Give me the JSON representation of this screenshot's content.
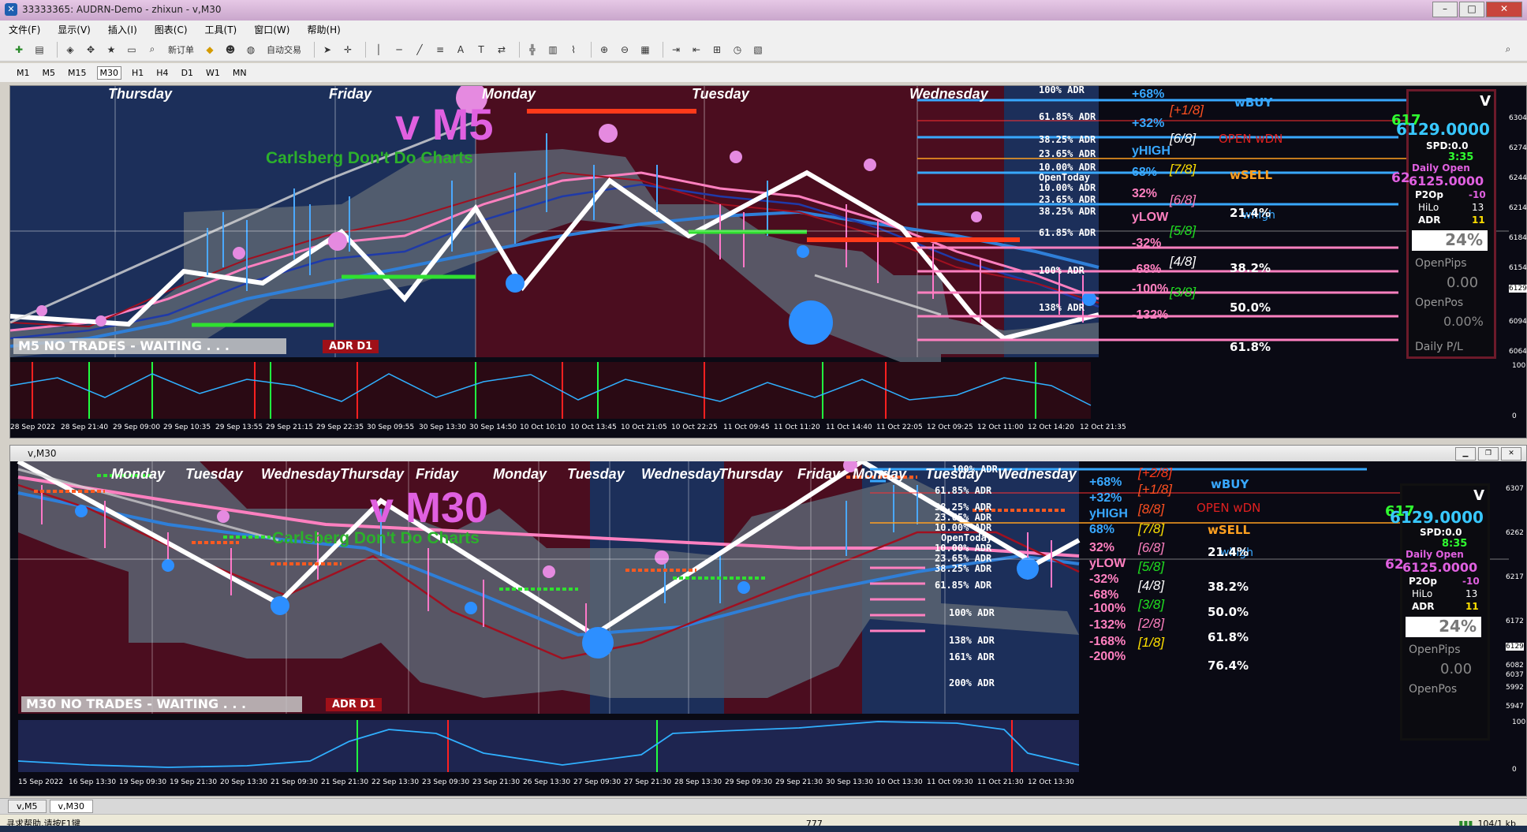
{
  "window": {
    "title": "33333365: AUDRN-Demo - zhixun - v,M30",
    "min": "–",
    "max": "□",
    "close": "✕"
  },
  "menu": [
    "文件(F)",
    "显示(V)",
    "插入(I)",
    "图表(C)",
    "工具(T)",
    "窗口(W)",
    "帮助(H)"
  ],
  "toolbar": {
    "new_order": "新订单",
    "auto_trade": "自动交易"
  },
  "timeframes": [
    "M1",
    "M5",
    "M15",
    "M30",
    "H1",
    "H4",
    "D1",
    "W1",
    "MN"
  ],
  "chart1": {
    "days": [
      "Thursday",
      "Friday",
      "Monday",
      "Tuesday",
      "Wednesday"
    ],
    "title": "v M5",
    "subtitle": "Carlsberg Don't Do Charts",
    "status": "M5  NO TRADES - WAITING . . .",
    "adr": "ADR D1",
    "adr_levels": [
      "100% ADR",
      "61.85% ADR",
      "38.25% ADR",
      "23.65% ADR",
      "10.00% ADR",
      "OpenToday",
      "10.00% ADR",
      "23.65% ADR",
      "38.25% ADR",
      "61.85% ADR",
      "100% ADR",
      "138% ADR"
    ],
    "pct_levels": [
      "+68%",
      "+32%",
      "yHIGH",
      "68%",
      "32%",
      "yLOW",
      "-32%",
      "-68%",
      "-100%",
      "-132%"
    ],
    "eighths": [
      "[+1/8]",
      "[6/8]",
      "[7/8]",
      "[6/8]",
      "[5/8]",
      "[4/8]",
      "[3/8]"
    ],
    "signals": {
      "wbuy": "wBUY",
      "open_wdn": "OPEN  wDN",
      "wsell": "wSELL",
      "whigh": "whigh"
    },
    "fibs": [
      "21.4%",
      "38.2%",
      "50.0%",
      "61.8%"
    ],
    "price_scale": [
      "6304",
      "6274",
      "6244",
      "6214",
      "6184",
      "6154",
      "6129",
      "6094",
      "6064"
    ],
    "osc_scale": [
      "100",
      "0"
    ],
    "time_axis": [
      "28 Sep 2022",
      "28 Sep 21:40",
      "29 Sep 09:00",
      "29 Sep 10:35",
      "29 Sep 13:55",
      "29 Sep 21:15",
      "29 Sep 22:35",
      "30 Sep 09:55",
      "30 Sep 13:30",
      "30 Sep 14:50",
      "10 Oct 10:10",
      "10 Oct 13:45",
      "10 Oct 21:05",
      "10 Oct 22:25",
      "11 Oct 09:45",
      "11 Oct 11:20",
      "11 Oct 14:40",
      "11 Oct 22:05",
      "12 Oct 09:25",
      "12 Oct 11:00",
      "12 Oct 14:20",
      "12 Oct 21:35"
    ],
    "panel": {
      "v": "V",
      "big1": "617",
      "price": "6129.0000",
      "spd": "SPD:0.0",
      "time": "3:35",
      "daily_open_label": "Daily Open",
      "daily_open_prefix": "62",
      "daily_open": "6125.0000",
      "p2op_label": "P2Op",
      "p2op": "-10",
      "hilo_label": "HiLo",
      "hilo": "13",
      "adr_label": "ADR",
      "adr": "11",
      "pct": "24%",
      "openpips_label": "OpenPips",
      "openpips": "0.00",
      "openpos_label": "OpenPos",
      "openpos": "0.00%",
      "dailypl_label": "Daily P/L"
    }
  },
  "chart2": {
    "window_title": "v,M30",
    "days": [
      "Monday",
      "Tuesday",
      "Wednesday",
      "Thursday",
      "Friday",
      "Monday",
      "Tuesday",
      "Wednesday",
      "Thursday",
      "Friday",
      "Monday",
      "Tuesday",
      "Wednesday"
    ],
    "title": "v M30",
    "subtitle": "Carlsberg Don't Do Charts",
    "status": "M30  NO TRADES - WAITING . . .",
    "adr": "ADR D1",
    "adr_levels": [
      "100% ADR",
      "61.85% ADR",
      "38.25% ADR",
      "23.65% ADR",
      "10.00% ADR",
      "OpenToday",
      "10.00% ADR",
      "23.65% ADR",
      "38.25% ADR",
      "61.85% ADR",
      "100% ADR",
      "138% ADR",
      "161% ADR",
      "200% ADR"
    ],
    "pct_levels": [
      "+68%",
      "+32%",
      "yHIGH",
      "68%",
      "32%",
      "yLOW",
      "-32%",
      "-68%",
      "-100%",
      "-132%",
      "-168%",
      "-200%"
    ],
    "eighths": [
      "[+2/8]",
      "[+1/8]",
      "[8/8]",
      "[7/8]",
      "[6/8]",
      "[5/8]",
      "[4/8]",
      "[3/8]",
      "[2/8]",
      "[1/8]"
    ],
    "signals": {
      "wbuy": "wBUY",
      "open_wdn": "OPEN  wDN",
      "wsell": "wSELL",
      "whigh": "whigh"
    },
    "fibs": [
      "21.4%",
      "38.2%",
      "50.0%",
      "61.8%",
      "76.4%"
    ],
    "price_scale": [
      "6307",
      "6262",
      "6217",
      "6172",
      "6129",
      "6082",
      "6037",
      "5992",
      "5947"
    ],
    "osc_scale": [
      "100",
      "0"
    ],
    "time_axis": [
      "15 Sep 2022",
      "16 Sep 13:30",
      "19 Sep 09:30",
      "19 Sep 21:30",
      "20 Sep 13:30",
      "21 Sep 09:30",
      "21 Sep 21:30",
      "22 Sep 13:30",
      "23 Sep 09:30",
      "23 Sep 21:30",
      "26 Sep 13:30",
      "27 Sep 09:30",
      "27 Sep 21:30",
      "28 Sep 13:30",
      "29 Sep 09:30",
      "29 Sep 21:30",
      "30 Sep 13:30",
      "10 Oct 13:30",
      "11 Oct 09:30",
      "11 Oct 21:30",
      "12 Oct 13:30"
    ],
    "panel": {
      "v": "V",
      "big1": "617",
      "price": "6129.0000",
      "spd": "SPD:0.0",
      "time": "8:35",
      "daily_open_label": "Daily Open",
      "daily_open_prefix": "62",
      "daily_open": "6125.0000",
      "p2op_label": "P2Op",
      "p2op": "-10",
      "hilo_label": "HiLo",
      "hilo": "13",
      "adr_label": "ADR",
      "adr": "11",
      "pct": "24%",
      "openpips_label": "OpenPips",
      "openpips": "0.00",
      "openpos_label": "OpenPos"
    }
  },
  "tabs": [
    "v,M5",
    "v,M30"
  ],
  "status": {
    "help": "寻求帮助,请按F1键",
    "count": "777",
    "traffic": "104/1 kb"
  }
}
